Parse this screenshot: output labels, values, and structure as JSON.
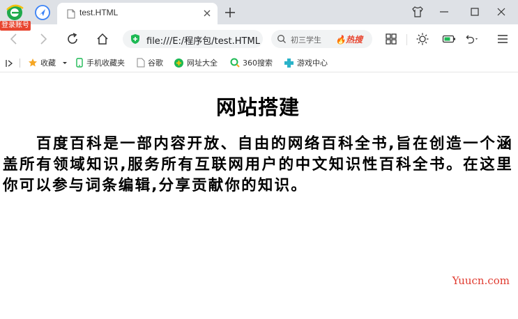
{
  "browser": {
    "login_badge": "登录账号",
    "tab": {
      "title": "test.HTML"
    },
    "address_bar": {
      "url": "file:///E:/程序包/test.HTML"
    },
    "search_box": {
      "text": "初三学生",
      "hot_label": "🔥热搜"
    }
  },
  "bookmarks": [
    {
      "label": "收藏",
      "icon": "star-icon"
    },
    {
      "label": "手机收藏夹",
      "icon": "phone-icon"
    },
    {
      "label": "谷歌",
      "icon": "doc-icon"
    },
    {
      "label": "网址大全",
      "icon": "globe-icon"
    },
    {
      "label": "360搜索",
      "icon": "search-360-icon"
    },
    {
      "label": "游戏中心",
      "icon": "game-icon"
    }
  ],
  "page": {
    "title": "网站搭建",
    "paragraph": "百度百科是一部内容开放、自由的网络百科全书,旨在创造一个涵盖所有领域知识,服务所有互联网用户的中文知识性百科全书。在这里你可以参与词条编辑,分享贡献你的知识。"
  },
  "watermark": "Yuucn.com",
  "colors": {
    "tabbar": "#dee1e6",
    "accent_green": "#1db954",
    "badge_red": "#e8452f",
    "watermark": "#e03a2f"
  }
}
